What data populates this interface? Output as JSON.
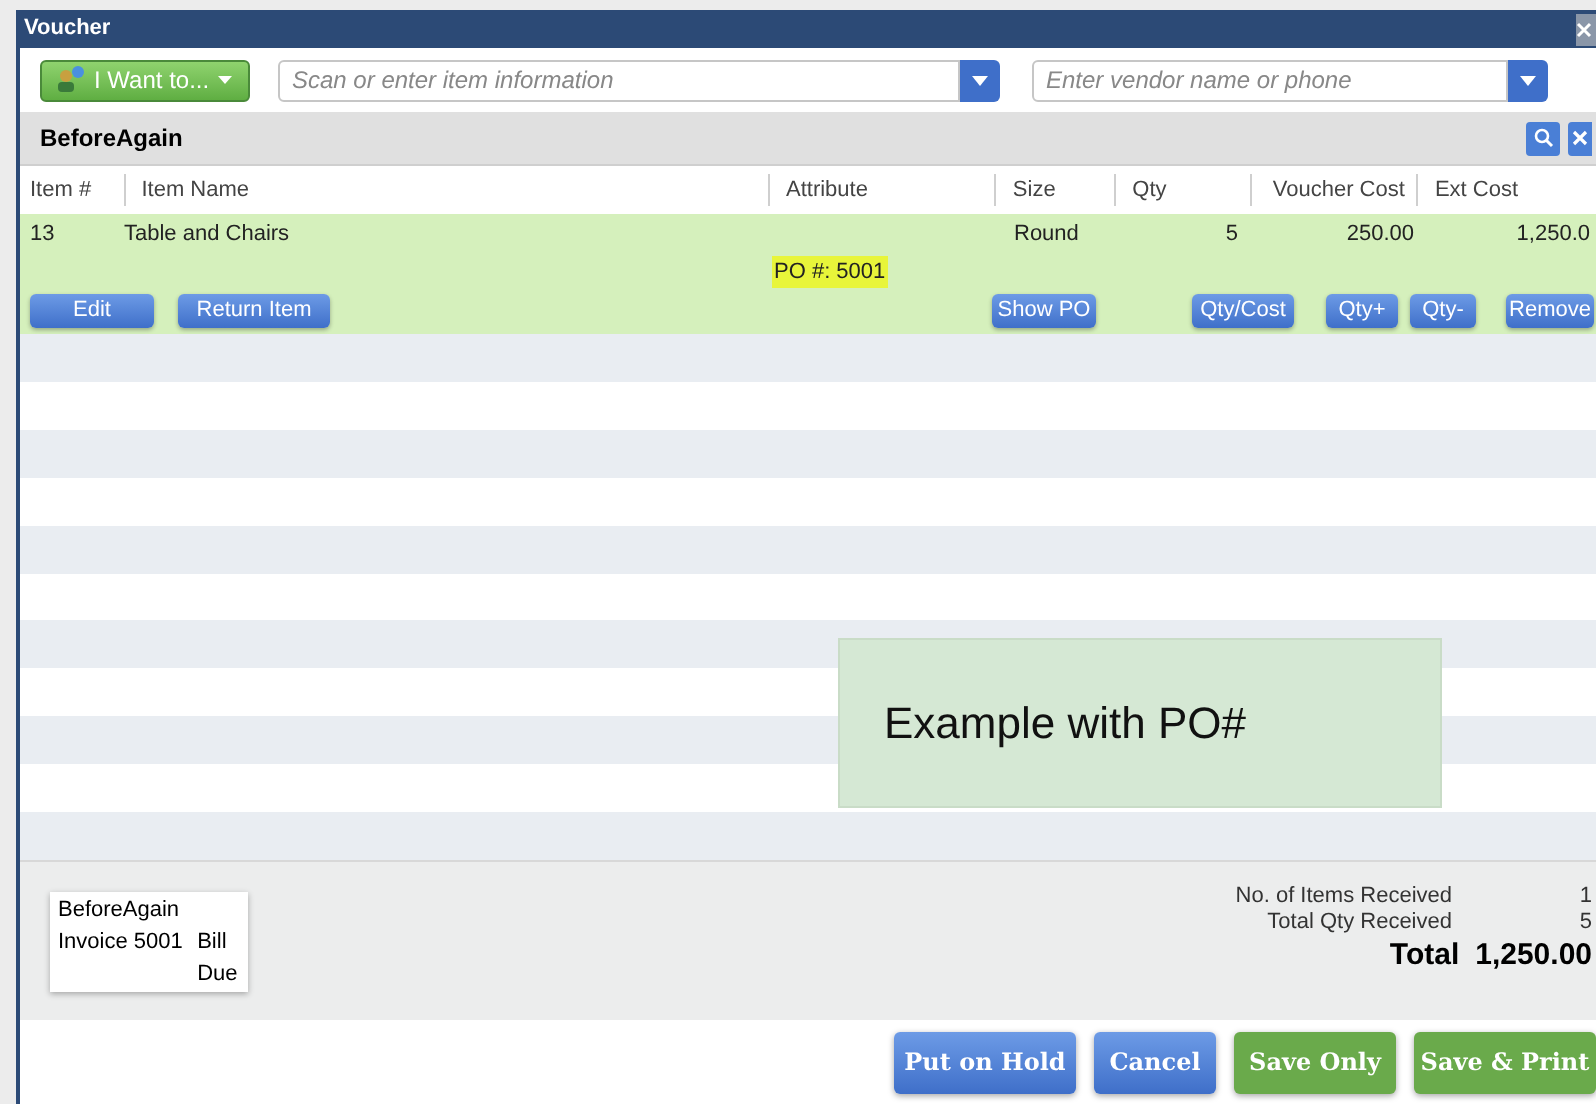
{
  "window": {
    "title": "Voucher"
  },
  "toolbar": {
    "action_menu": "I Want to...",
    "item_search": {
      "placeholder": "Scan or enter item information"
    },
    "vendor_search": {
      "placeholder": "Enter vendor name or phone"
    }
  },
  "vendor": {
    "name": "BeforeAgain"
  },
  "table": {
    "columns": [
      "Item #",
      "Item Name",
      "Attribute",
      "Size",
      "Qty",
      "Voucher Cost",
      "Ext Cost"
    ],
    "rows": [
      {
        "item_no": "13",
        "item_name": "Table and Chairs",
        "attribute": "PO #: 5001",
        "size": "Round",
        "qty": "5",
        "voucher_cost": "250.00",
        "ext_cost": "1,250.0",
        "selected": true,
        "actions": [
          "Edit",
          "Return Item",
          "Show PO",
          "Qty/Cost",
          "Qty+",
          "Qty-",
          "Remove"
        ]
      }
    ]
  },
  "summary_card": {
    "vendor": "BeforeAgain",
    "invoice": "Invoice 5001",
    "status_line_1": "Bill",
    "status_line_2": "Due"
  },
  "totals": [
    {
      "label": "No. of Items Received",
      "value": "1"
    },
    {
      "label": "Total Qty Received",
      "value": "5"
    }
  ],
  "grand_total": {
    "label": "Total",
    "value": "1,250.00"
  },
  "buttons": [
    {
      "label": "Put on Hold",
      "kind": "blue"
    },
    {
      "label": "Cancel",
      "kind": "blue"
    },
    {
      "label": "Save Only",
      "kind": "green"
    },
    {
      "label": "Save & Print",
      "kind": "green"
    }
  ],
  "note": {
    "text": "Example with PO#"
  }
}
